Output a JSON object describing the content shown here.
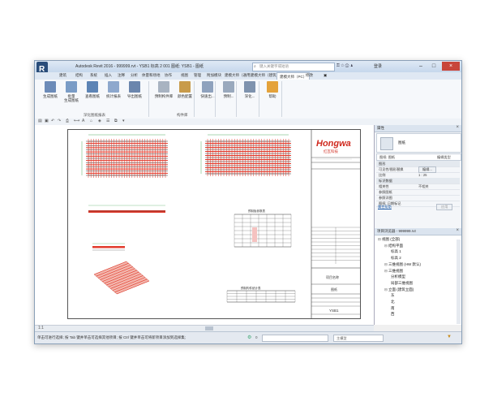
{
  "window": {
    "title": "Autodesk Revit 2016 -   999999.rvt - YSB1 标高 2 001 图纸: YSB1 - 图纸",
    "search_placeholder": "键入关键字或短语",
    "login": "登录"
  },
  "tabs": [
    "建筑",
    "结构",
    "系统",
    "插入",
    "注释",
    "分析",
    "体量和场地",
    "协作",
    "视图",
    "管理",
    "附加模块",
    "建模大师（通用）",
    "建模大师（建筑）",
    "建模大师（PC）",
    "修改"
  ],
  "active_tab": "建模大师（PC）",
  "ribbon": {
    "buttons": [
      {
        "label": "生成图纸",
        "color": "#6c8bb8"
      },
      {
        "label": "批量\n生成图纸",
        "color": "#7a9cc6"
      },
      {
        "label": "查看图纸",
        "color": "#5d84b5"
      },
      {
        "label": "统计报表",
        "color": "#8ea8cd"
      },
      {
        "label": "导出图纸",
        "color": "#6b86ad"
      },
      {
        "label": "预制构件库",
        "color": "#a8b3c1"
      },
      {
        "label": "颜色配置",
        "color": "#c89b4a"
      },
      {
        "label": "快速出...",
        "color": "#8fa2bd"
      },
      {
        "label": "预制...",
        "color": "#9aa9bd"
      },
      {
        "label": "深化...",
        "color": "#7f93ae"
      },
      {
        "label": "帮助",
        "color": "#e4a23a"
      }
    ],
    "groups": [
      "深化图纸报表",
      "构件库"
    ]
  },
  "drawing": {
    "logo_text": "Hongwa",
    "logo_sub": "红瓦科技",
    "table1_title": "预制板参数表",
    "table2_title": "预制构件统计表",
    "sheet_label": "项目名称",
    "sheet_name": "图纸",
    "sheet_number": "YSB1",
    "colors": {
      "rebar_red": "#e23b2c",
      "rebar_dark": "#333333",
      "logo_red": "#d02a1f"
    }
  },
  "canvas_scale": "1:1",
  "properties": {
    "header": "属性",
    "type_name": "图纸",
    "selector": "图纸: 图纸",
    "edit_type": "编辑类型",
    "rows": [
      {
        "k": "图形",
        "v": "",
        "section": true
      },
      {
        "k": "可见性/图形替换",
        "v": "编辑..."
      },
      {
        "k": "比例",
        "v": "1 : 25"
      },
      {
        "k": "标识数据",
        "v": "",
        "section": true
      },
      {
        "k": "相关性",
        "v": "不相关"
      },
      {
        "k": "参照图纸",
        "v": ""
      },
      {
        "k": "参照详图",
        "v": ""
      },
      {
        "k": "图纸: 日期标记",
        "v": ""
      }
    ],
    "help_link": "属性帮助",
    "apply": "应用"
  },
  "browser": {
    "header": "项目浏览器 - 999999.rvt",
    "nodes": [
      {
        "text": "视图 (全部)",
        "depth": 0
      },
      {
        "text": "结构平面",
        "depth": 1
      },
      {
        "text": "标高 1",
        "depth": 2
      },
      {
        "text": "标高 2",
        "depth": 2
      },
      {
        "text": "三维视图 (HW 默认)",
        "depth": 1
      },
      {
        "text": "三维视图",
        "depth": 1
      },
      {
        "text": "分析模型",
        "depth": 2
      },
      {
        "text": "局部三维视图",
        "depth": 2
      },
      {
        "text": "立面 (建筑立面)",
        "depth": 1
      },
      {
        "text": "东",
        "depth": 2
      },
      {
        "text": "北",
        "depth": 2
      },
      {
        "text": "南",
        "depth": 2
      },
      {
        "text": "西",
        "depth": 2
      }
    ]
  },
  "status": {
    "text": "单击可进行选择; 按 Tab 键并单击可选择其他项目; 按 Ctrl 键并单击可将新项目添加到选择集;",
    "model": "主模型",
    "count": "0"
  }
}
